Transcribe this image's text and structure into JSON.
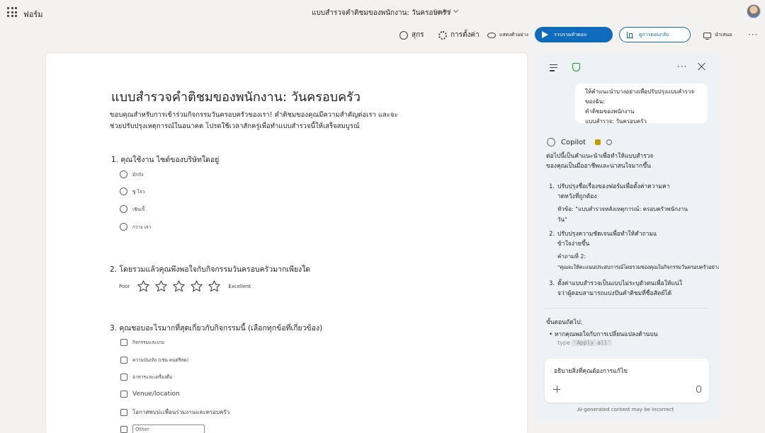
{
  "app": {
    "name": "ฟอร์ม"
  },
  "document": {
    "title": "แบบสำรวจคำติชมของพนักงาน: วันครอบครัว",
    "status": "Saved"
  },
  "toolbar": {
    "style_label": "สุกร",
    "settings_label": "การตั้งค่า",
    "preview_label": "แสดงตัวอย่าง",
    "collect_label": "รวบรวมคำตอบ",
    "responses_label": "ดูการตอบกลับ",
    "present_label": "นำเสนอ"
  },
  "form": {
    "title": "แบบสำรวจคำติชมของพนักงาน: วันครอบครัว",
    "description": "ขอบคุณสำหรับการเข้าร่วมกิจกรรมวันครอบครัวของเรา! คำติชมของคุณมีความสำคัญต่อเรา และจะช่วยปรับปรุงเหตุการณ์ในอนาคต โปรดใช้เวลาสักครู่เพื่อทำแบบสำรวจนี้ให้เสร็จสมบูรณ์",
    "q1": {
      "title": "1. คุณใช้งาน ไซต์ของบริษัทใดอยู่",
      "options": [
        "มักกัง",
        "ซู โจว",
        "เซินเจิ้",
        "กวาง เจา"
      ]
    },
    "q2": {
      "title": "2. โดยรวมแล้วคุณพึงพอใจกับกิจกรรมวันครอบครัวมากเพียงใด",
      "low_label": "Poor",
      "high_label": "Excellent",
      "stars": 5
    },
    "q3": {
      "title": "3. คุณชอบอะไรมากที่สุดเกี่ยวกับกิจกรรมนี้ (เลือกทุกข้อที่เกี่ยวข้อง)",
      "options": [
        "กิจกรรมและเกม",
        "ความบันเทิง (เช่น ดนตรีสด)",
        "อาหารและเครื่องดื่ม",
        "Venue/location",
        "โอกาสพบปะเพื่อนร่วมงานและครอบครัว"
      ],
      "other_placeholder": "Other"
    }
  },
  "copilot": {
    "user_message": [
      "ให้คำแนะนำบางอย่างเพื่อปรับปรุงแบบสำรวจของฉัน:",
      "คำติชมของพนักงาน",
      "แบบสำรวจ: วันครอบครัว"
    ],
    "brand": "Copilot",
    "intro": [
      "ต่อไปนี้เป็นคำแนะนำเพื่อทำให้แบบสำรวจ",
      "ของคุณเป็นมืออาชีพและน่าสนใจมากขึ้น"
    ],
    "suggestions": [
      {
        "num": "1.",
        "lines": [
          "ปรับปรุงชื่อเรื่องของฟอร์มเพื่อตั้งค่าความคา",
          "าดหวังที่ถูกต้อง"
        ],
        "detail": [
          "หัวข้อ: \"แบบสำรวจหลังเหตุการณ์: ครอบครัวพนักงาน",
          "วัน\""
        ]
      },
      {
        "num": "2.",
        "lines": [
          "ปรับปรุงความชัดเจนเพื่อทำให้คำถามแ",
          "ข้าใจง่ายขึ้น"
        ],
        "detail": [
          "คำถามที่ 2:",
          "\"คุณจะให้คะแนนประสบการณ์โดยรวมของคุณในกิจกรรมวันครอบครัวอย่างไร\""
        ]
      },
      {
        "num": "3.",
        "lines": [
          "ตั้งค่าแบบสำรวจเป็นแบบไม่ระบุตัวตนเพื่อให้แน่ใ",
          "จว่าผู้ตอบสามารถแบ่งปันคำติชมที่ซื่อสัตย์ได้"
        ],
        "detail": []
      }
    ],
    "next_steps_label": "ขั้นตอนถัดไป:",
    "bullet_text": "หากคุณพอใจกับการเปลี่ยนแปลงด้านบน",
    "bullet_faded_prefix": "type",
    "bullet_faded_code": "'Apply all'",
    "compose_placeholder": "อธิบายสิ่งที่คุณต้องการแก้ไข",
    "disclaimer": "AI-generated content may be incorrect"
  }
}
